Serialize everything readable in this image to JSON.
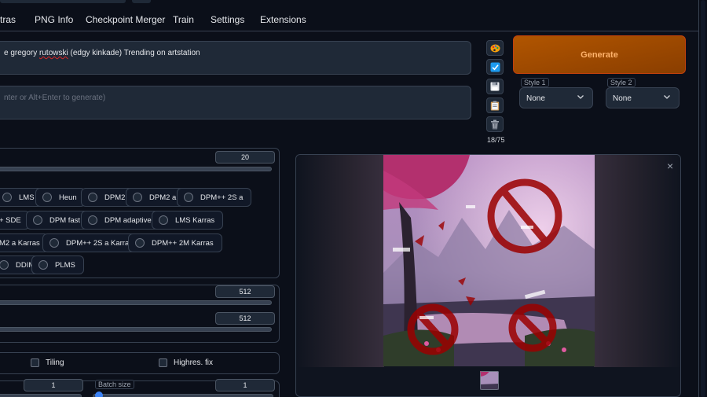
{
  "tabs": [
    "tras",
    "PNG Info",
    "Checkpoint Merger",
    "Train",
    "Settings",
    "Extensions"
  ],
  "prompt": {
    "before": "e gregory ",
    "squiggle": "rutowski",
    "after": " (edgy kinkade) Trending on artstation"
  },
  "negative_prompt": {
    "placeholder": "nter or Alt+Enter to generate)"
  },
  "token_count": "18/75",
  "generate_label": "Generate",
  "styles": [
    {
      "label": "Style 1",
      "value": "None"
    },
    {
      "label": "Style 2",
      "value": "None"
    }
  ],
  "sampling_steps": "20",
  "samplers": {
    "row1": [
      "LMS",
      "Heun",
      "DPM2",
      "DPM2 a",
      "DPM++ 2S a"
    ],
    "row2": [
      "+ SDE",
      "DPM fast",
      "DPM adaptive",
      "LMS Karras"
    ],
    "row3": [
      "M2 a Karras",
      "DPM++ 2S a Karras",
      "DPM++ 2M Karras"
    ],
    "row4": [
      "DDIM",
      "PLMS"
    ]
  },
  "width": "512",
  "height": "512",
  "options": {
    "tiling": "Tiling",
    "highres": "Highres. fix"
  },
  "batch": {
    "count": "1",
    "size_label": "Batch size",
    "size": "1"
  },
  "colors": {
    "accent": "#b15500",
    "background": "#0b0f19",
    "panel": "#1f2937",
    "censor": "#9b0000"
  }
}
